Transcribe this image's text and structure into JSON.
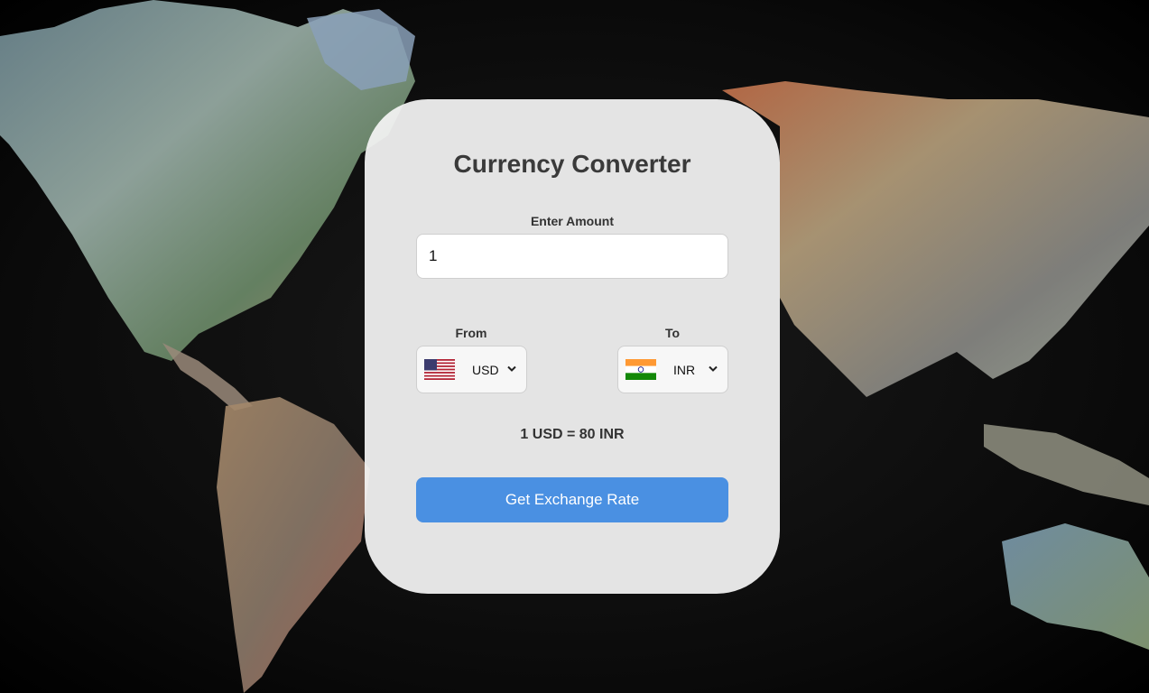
{
  "app": {
    "title": "Currency Converter"
  },
  "amount": {
    "label": "Enter Amount",
    "value": "1"
  },
  "from": {
    "label": "From",
    "currency": "USD",
    "flag_icon": "us-flag-icon"
  },
  "to": {
    "label": "To",
    "currency": "INR",
    "flag_icon": "india-flag-icon"
  },
  "result": {
    "text": "1 USD = 80 INR"
  },
  "actions": {
    "exchange_label": "Get Exchange Rate"
  },
  "colors": {
    "accent": "#4a90e2",
    "card": "#f4f4f4",
    "background": "#0a0a0a"
  }
}
